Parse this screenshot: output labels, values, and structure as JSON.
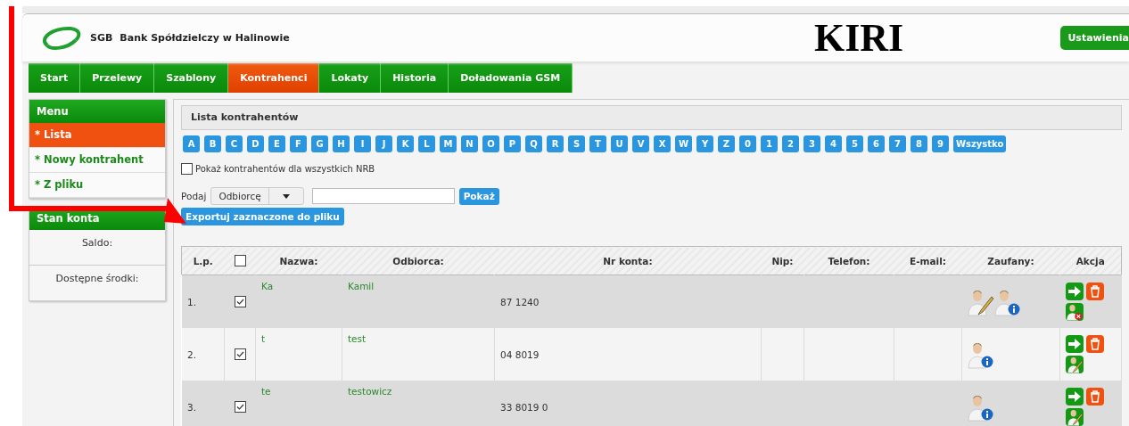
{
  "header": {
    "bank_name": "Bank Spółdzielczy w Halinowie",
    "logo_text": "SGB",
    "app_title": "KIRI",
    "settings_button": "Ustawienia"
  },
  "nav": [
    {
      "label": "Start",
      "selected": false
    },
    {
      "label": "Przelewy",
      "selected": false
    },
    {
      "label": "Szablony",
      "selected": false
    },
    {
      "label": "Kontrahenci",
      "selected": true
    },
    {
      "label": "Lokaty",
      "selected": false
    },
    {
      "label": "Historia",
      "selected": false
    },
    {
      "label": "Doładowania GSM",
      "selected": false
    }
  ],
  "sidebar": {
    "menu_title": "Menu",
    "items": [
      {
        "label": "* Lista",
        "selected": true
      },
      {
        "label": "* Nowy kontrahent",
        "selected": false
      },
      {
        "label": "* Z pliku",
        "selected": false
      }
    ],
    "account_title": "Stan konta",
    "balance_label": "Saldo:",
    "available_label": "Dostępne środki:"
  },
  "panel": {
    "title": "Lista kontrahentów",
    "letters": [
      "A",
      "B",
      "C",
      "D",
      "E",
      "F",
      "G",
      "H",
      "I",
      "J",
      "K",
      "L",
      "M",
      "N",
      "O",
      "P",
      "Q",
      "R",
      "S",
      "T",
      "U",
      "V",
      "X",
      "W",
      "Y",
      "Z",
      "0",
      "1",
      "2",
      "3",
      "4",
      "5",
      "6",
      "7",
      "8",
      "9",
      "Wszystko"
    ],
    "show_all_nrb": {
      "label": "Pokaż kontrahentów dla wszystkich NRB",
      "checked": false
    },
    "search": {
      "label": "Podaj",
      "field_select": "Odbiorcę",
      "button": "Pokaż"
    },
    "export_button": "Exportuj zaznaczone do pliku"
  },
  "table": {
    "columns": [
      "L.p.",
      "Nazwa:",
      "Odbiorca:",
      "Nr konta:",
      "Nip:",
      "Telefon:",
      "E-mail:",
      "Zaufany:",
      "Akcja"
    ],
    "select_all": false,
    "rows": [
      {
        "lp": "1.",
        "checked": true,
        "name": "Ka",
        "recipient": "Kamil",
        "account": "87 1240",
        "trusted": true
      },
      {
        "lp": "2.",
        "checked": true,
        "name": "t",
        "recipient": "test",
        "account": "04 8019",
        "trusted": false
      },
      {
        "lp": "3.",
        "checked": true,
        "name": "te",
        "recipient": "testowicz",
        "account": "33 8019 0",
        "trusted": false
      }
    ]
  },
  "annotation": {
    "kind": "arrow"
  }
}
